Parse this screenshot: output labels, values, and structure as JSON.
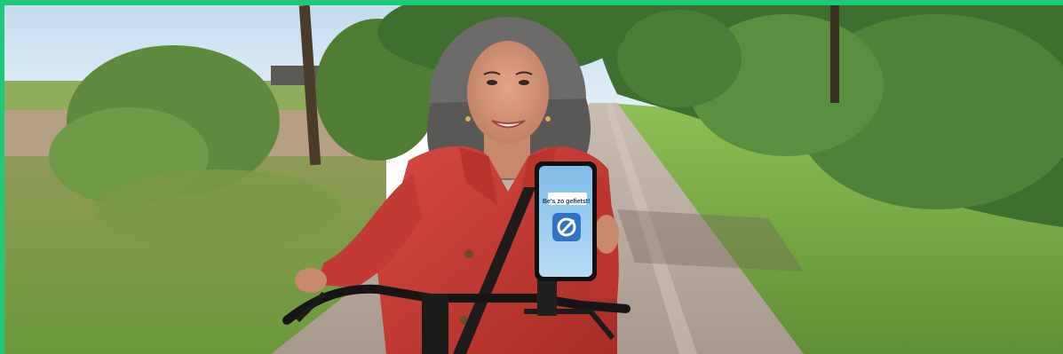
{
  "colors": {
    "accent_bar": "#1ec97a",
    "sky": "#cfe3f3",
    "jacket": "#c73b33",
    "path": "#b7aa9f",
    "grass": "#7fa94a",
    "phone_screen": "#9cccef"
  },
  "phone": {
    "app_caption": "Be's zo gefietst!",
    "app_icon": "cycling-app-logo-icon"
  }
}
